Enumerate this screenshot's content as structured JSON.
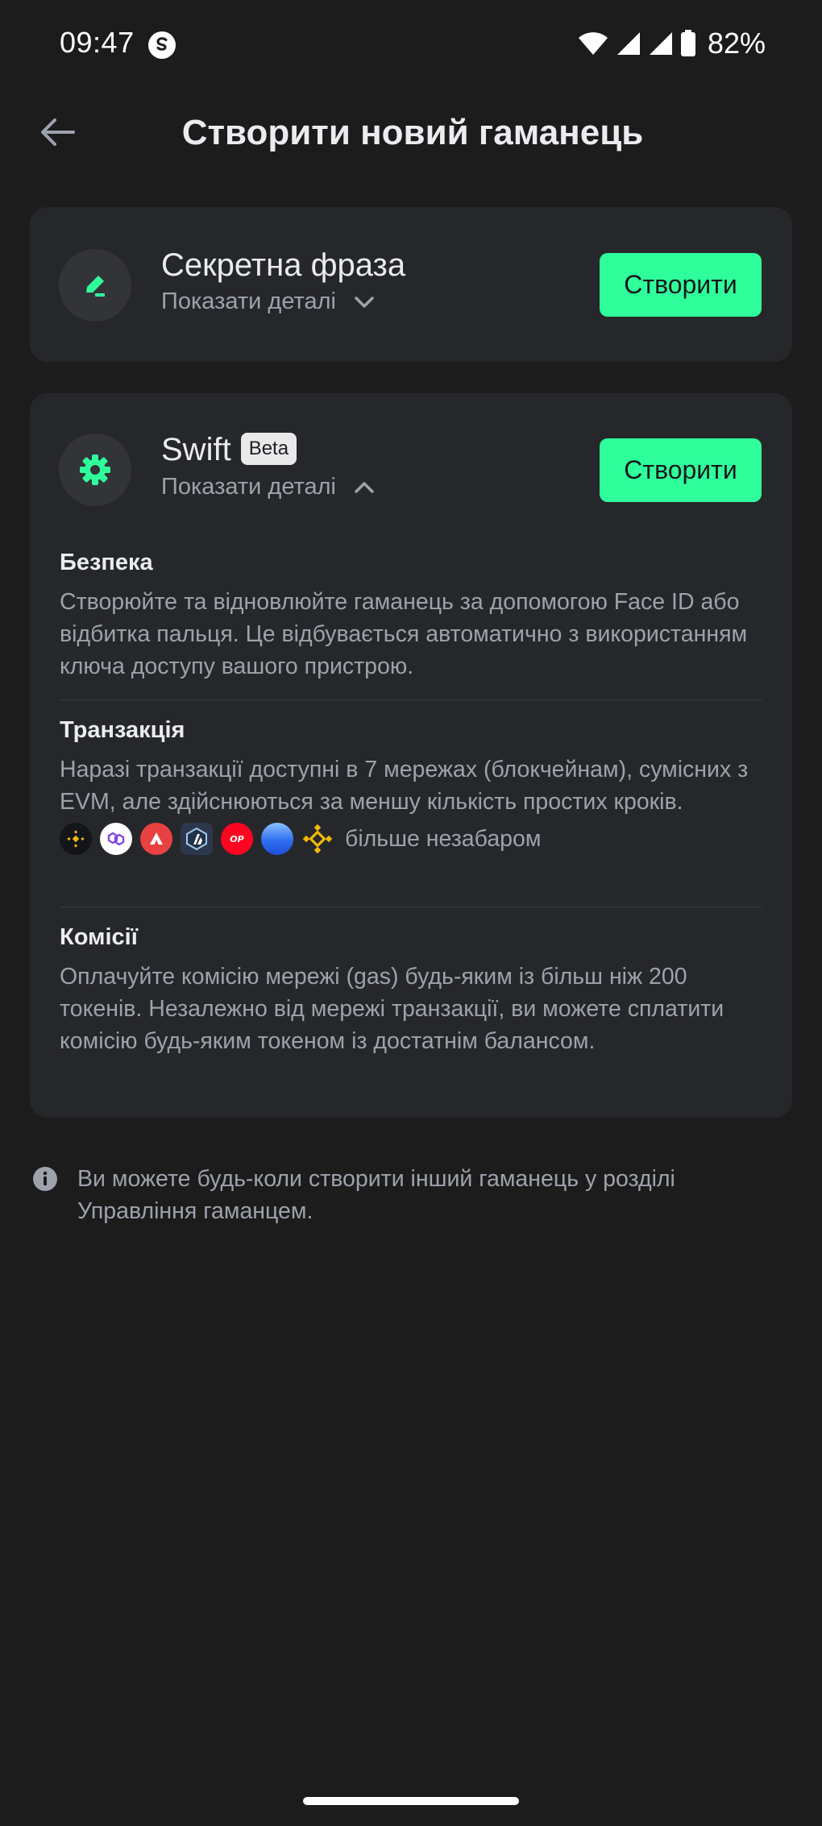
{
  "status_bar": {
    "time": "09:47",
    "battery": "82%",
    "icons": [
      "app-s-icon",
      "wifi-icon",
      "signal-icon",
      "signal-icon",
      "battery-icon"
    ]
  },
  "header": {
    "title": "Створити новий гаманець",
    "back_icon": "arrow-left-icon"
  },
  "secret_phrase": {
    "icon": "pen-icon",
    "title": "Секретна фраза",
    "details_label": "Показати деталі",
    "details_icon": "chevron-down-icon",
    "button_label": "Створити"
  },
  "swift": {
    "icon": "gear-badge-icon",
    "title": "Swift",
    "badge": "Beta",
    "details_label": "Показати деталі",
    "details_icon": "chevron-up-icon",
    "button_label": "Створити",
    "sections": {
      "security": {
        "title": "Безпека",
        "body": "Створюйте та відновлюйте гаманець за допомогою Face ID або відбитка пальця. Це відбувається автоматично з використанням ключа доступу вашого пристрою."
      },
      "transactions": {
        "title": "Транзакція",
        "body": "Наразі транзакції доступні в 7 мережах (блокчейнам), сумісних з EVM, але здійснюються за меншу кількість простих кроків.",
        "chains": [
          "bnb-icon",
          "polygon-icon",
          "avalanche-icon",
          "arbitrum-icon",
          "optimism-icon",
          "base-icon",
          "opbnb-icon"
        ],
        "more_label": "більше незабаром"
      },
      "fees": {
        "title": "Комісії",
        "body": "Оплачуйте комісію мережі (gas) будь-яким із більш ніж 200 токенів. Незалежно від мережі транзакції, ви можете сплатити комісію будь-яким токеном із достатнім балансом."
      }
    }
  },
  "info_note": {
    "icon": "info-icon",
    "text": "Ви можете будь-коли створити інший гаманець у розділі Управління гаманцем."
  },
  "colors": {
    "background": "#1c1c1d",
    "card": "#26272b",
    "accent": "#2fff9b",
    "text_primary": "#eaecef",
    "text_secondary": "#9da2ab"
  }
}
